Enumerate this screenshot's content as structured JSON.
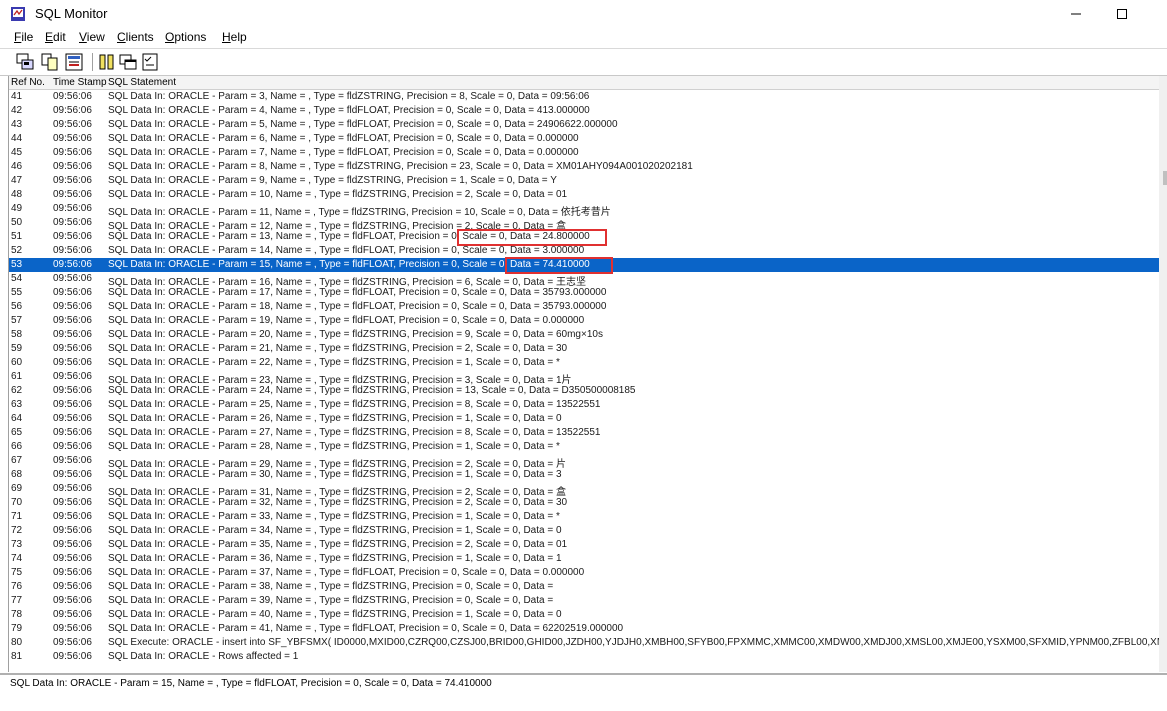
{
  "window": {
    "title": "SQL Monitor"
  },
  "menu": [
    {
      "acc": "F",
      "rest": "ile"
    },
    {
      "acc": "E",
      "rest": "dit"
    },
    {
      "acc": "V",
      "rest": "iew"
    },
    {
      "acc": "C",
      "rest": "lients"
    },
    {
      "acc": "O",
      "rest": "ptions"
    },
    {
      "acc": "H",
      "rest": "elp"
    }
  ],
  "columns": {
    "ref": "Ref No.",
    "time": "Time Stamp",
    "sql": "SQL Statement"
  },
  "rows": [
    {
      "ref": "41",
      "time": "09:56:06",
      "sql": "SQL Data In: ORACLE - Param = 3, Name = , Type = fldZSTRING, Precision = 8, Scale = 0, Data = 09:56:06"
    },
    {
      "ref": "42",
      "time": "09:56:06",
      "sql": "SQL Data In: ORACLE - Param = 4, Name = , Type = fldFLOAT, Precision = 0, Scale = 0, Data = 413.000000"
    },
    {
      "ref": "43",
      "time": "09:56:06",
      "sql": "SQL Data In: ORACLE - Param = 5, Name = , Type = fldFLOAT, Precision = 0, Scale = 0, Data = 24906622.000000"
    },
    {
      "ref": "44",
      "time": "09:56:06",
      "sql": "SQL Data In: ORACLE - Param = 6, Name = , Type = fldFLOAT, Precision = 0, Scale = 0, Data = 0.000000"
    },
    {
      "ref": "45",
      "time": "09:56:06",
      "sql": "SQL Data In: ORACLE - Param = 7, Name = , Type = fldFLOAT, Precision = 0, Scale = 0, Data = 0.000000"
    },
    {
      "ref": "46",
      "time": "09:56:06",
      "sql": "SQL Data In: ORACLE - Param = 8, Name = , Type = fldZSTRING, Precision = 23, Scale = 0, Data = XM01AHY094A001020202181"
    },
    {
      "ref": "47",
      "time": "09:56:06",
      "sql": "SQL Data In: ORACLE - Param = 9, Name = , Type = fldZSTRING, Precision = 1, Scale = 0, Data = Y"
    },
    {
      "ref": "48",
      "time": "09:56:06",
      "sql": "SQL Data In: ORACLE - Param = 10, Name = , Type = fldZSTRING, Precision = 2, Scale = 0, Data = 01"
    },
    {
      "ref": "49",
      "time": "09:56:06",
      "sql": "SQL Data In: ORACLE - Param = 11, Name = , Type = fldZSTRING, Precision = 10, Scale = 0, Data = 依托考昔片"
    },
    {
      "ref": "50",
      "time": "09:56:06",
      "sql": "SQL Data In: ORACLE - Param = 12, Name = , Type = fldZSTRING, Precision = 2, Scale = 0, Data = 盒"
    },
    {
      "ref": "51",
      "time": "09:56:06",
      "sql": "SQL Data In: ORACLE - Param = 13, Name = , Type = fldFLOAT, Precision = 0, Scale = 0, Data = 24.800000"
    },
    {
      "ref": "52",
      "time": "09:56:06",
      "sql": "SQL Data In: ORACLE - Param = 14, Name = , Type = fldFLOAT, Precision = 0, Scale = 0, Data = 3.000000"
    },
    {
      "ref": "53",
      "time": "09:56:06",
      "sql": "SQL Data In: ORACLE - Param = 15, Name = , Type = fldFLOAT, Precision = 0, Scale = 0, Data = 74.410000"
    },
    {
      "ref": "54",
      "time": "09:56:06",
      "sql": "SQL Data In: ORACLE - Param = 16, Name = , Type = fldZSTRING, Precision = 6, Scale = 0, Data = 王志坚"
    },
    {
      "ref": "55",
      "time": "09:56:06",
      "sql": "SQL Data In: ORACLE - Param = 17, Name = , Type = fldFLOAT, Precision = 0, Scale = 0, Data = 35793.000000"
    },
    {
      "ref": "56",
      "time": "09:56:06",
      "sql": "SQL Data In: ORACLE - Param = 18, Name = , Type = fldFLOAT, Precision = 0, Scale = 0, Data = 35793.000000"
    },
    {
      "ref": "57",
      "time": "09:56:06",
      "sql": "SQL Data In: ORACLE - Param = 19, Name = , Type = fldFLOAT, Precision = 0, Scale = 0, Data = 0.000000"
    },
    {
      "ref": "58",
      "time": "09:56:06",
      "sql": "SQL Data In: ORACLE - Param = 20, Name = , Type = fldZSTRING, Precision = 9, Scale = 0, Data = 60mg×10s"
    },
    {
      "ref": "59",
      "time": "09:56:06",
      "sql": "SQL Data In: ORACLE - Param = 21, Name = , Type = fldZSTRING, Precision = 2, Scale = 0, Data = 30"
    },
    {
      "ref": "60",
      "time": "09:56:06",
      "sql": "SQL Data In: ORACLE - Param = 22, Name = , Type = fldZSTRING, Precision = 1, Scale = 0, Data = *"
    },
    {
      "ref": "61",
      "time": "09:56:06",
      "sql": "SQL Data In: ORACLE - Param = 23, Name = , Type = fldZSTRING, Precision = 3, Scale = 0, Data = 1片"
    },
    {
      "ref": "62",
      "time": "09:56:06",
      "sql": "SQL Data In: ORACLE - Param = 24, Name = , Type = fldZSTRING, Precision = 13, Scale = 0, Data = D350500008185"
    },
    {
      "ref": "63",
      "time": "09:56:06",
      "sql": "SQL Data In: ORACLE - Param = 25, Name = , Type = fldZSTRING, Precision = 8, Scale = 0, Data = 13522551"
    },
    {
      "ref": "64",
      "time": "09:56:06",
      "sql": "SQL Data In: ORACLE - Param = 26, Name = , Type = fldZSTRING, Precision = 1, Scale = 0, Data = 0"
    },
    {
      "ref": "65",
      "time": "09:56:06",
      "sql": "SQL Data In: ORACLE - Param = 27, Name = , Type = fldZSTRING, Precision = 8, Scale = 0, Data = 13522551"
    },
    {
      "ref": "66",
      "time": "09:56:06",
      "sql": "SQL Data In: ORACLE - Param = 28, Name = , Type = fldZSTRING, Precision = 1, Scale = 0, Data = *"
    },
    {
      "ref": "67",
      "time": "09:56:06",
      "sql": "SQL Data In: ORACLE - Param = 29, Name = , Type = fldZSTRING, Precision = 2, Scale = 0, Data = 片"
    },
    {
      "ref": "68",
      "time": "09:56:06",
      "sql": "SQL Data In: ORACLE - Param = 30, Name = , Type = fldZSTRING, Precision = 1, Scale = 0, Data = 3"
    },
    {
      "ref": "69",
      "time": "09:56:06",
      "sql": "SQL Data In: ORACLE - Param = 31, Name = , Type = fldZSTRING, Precision = 2, Scale = 0, Data = 盒"
    },
    {
      "ref": "70",
      "time": "09:56:06",
      "sql": "SQL Data In: ORACLE - Param = 32, Name = , Type = fldZSTRING, Precision = 2, Scale = 0, Data = 30"
    },
    {
      "ref": "71",
      "time": "09:56:06",
      "sql": "SQL Data In: ORACLE - Param = 33, Name = , Type = fldZSTRING, Precision = 1, Scale = 0, Data = *"
    },
    {
      "ref": "72",
      "time": "09:56:06",
      "sql": "SQL Data In: ORACLE - Param = 34, Name = , Type = fldZSTRING, Precision = 1, Scale = 0, Data = 0"
    },
    {
      "ref": "73",
      "time": "09:56:06",
      "sql": "SQL Data In: ORACLE - Param = 35, Name = , Type = fldZSTRING, Precision = 2, Scale = 0, Data = 01"
    },
    {
      "ref": "74",
      "time": "09:56:06",
      "sql": "SQL Data In: ORACLE - Param = 36, Name = , Type = fldZSTRING, Precision = 1, Scale = 0, Data = 1"
    },
    {
      "ref": "75",
      "time": "09:56:06",
      "sql": "SQL Data In: ORACLE - Param = 37, Name = , Type = fldFLOAT, Precision = 0, Scale = 0, Data = 0.000000"
    },
    {
      "ref": "76",
      "time": "09:56:06",
      "sql": "SQL Data In: ORACLE - Param = 38, Name = , Type = fldZSTRING, Precision = 0, Scale = 0, Data ="
    },
    {
      "ref": "77",
      "time": "09:56:06",
      "sql": "SQL Data In: ORACLE - Param = 39, Name = , Type = fldZSTRING, Precision = 0, Scale = 0, Data ="
    },
    {
      "ref": "78",
      "time": "09:56:06",
      "sql": "SQL Data In: ORACLE - Param = 40, Name = , Type = fldZSTRING, Precision = 1, Scale = 0, Data = 0"
    },
    {
      "ref": "79",
      "time": "09:56:06",
      "sql": "SQL Data In: ORACLE - Param = 41, Name = , Type = fldFLOAT, Precision = 0, Scale = 0, Data = 62202519.000000"
    },
    {
      "ref": "80",
      "time": "09:56:06",
      "sql": "SQL Execute: ORACLE - insert into SF_YBFSMX(  ID0000,MXID00,CZRQ00,CZSJ00,BRID00,GHID00,JZDH00,YJDJH0,XMBH00,SFYB00,FPXMMC,XMMC00,XMDW00,XMDJ00,XMSL00,XMJE00,YSXM00,SFXMID,YPNM00,ZFBL00,XMG"
    },
    {
      "ref": "81",
      "time": "09:56:06",
      "sql": "SQL Data In: ORACLE - Rows affected = 1"
    }
  ],
  "selected_ref": "53",
  "status": {
    "text": "SQL Data In: ORACLE - Param = 15, Name = , Type = fldFLOAT, Precision = 0, Scale = 0, Data = 74.410000"
  },
  "colors": {
    "selection": "#0a64c8",
    "highlight_box": "#e03030"
  }
}
